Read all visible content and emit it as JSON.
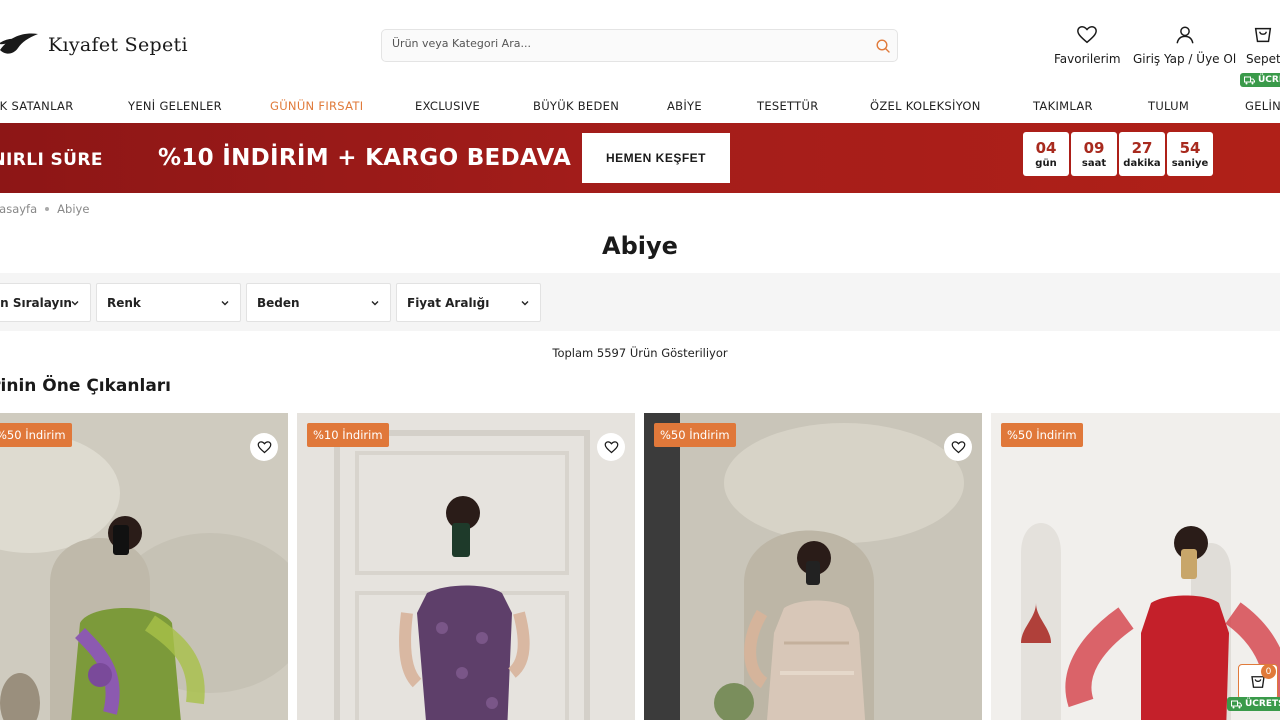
{
  "brand": {
    "name": "Kıyafet Sepeti"
  },
  "search": {
    "placeholder": "Ürün veya Kategori Ara..."
  },
  "header_actions": {
    "favorites": "Favorilerim",
    "login": "Giriş Yap / Üye Ol",
    "cart": "Sepet",
    "free_shipping": "ÜCRE"
  },
  "nav": [
    {
      "label": "ÇOK SATANLAR"
    },
    {
      "label": "YENİ GELENLER"
    },
    {
      "label": "GÜNÜN FIRSATI",
      "highlight": true
    },
    {
      "label": "EXCLUSIVE"
    },
    {
      "label": "BÜYÜK BEDEN"
    },
    {
      "label": "ABİYE"
    },
    {
      "label": "TESETTÜR"
    },
    {
      "label": "ÖZEL KOLEKSİYON"
    },
    {
      "label": "TAKIMLAR"
    },
    {
      "label": "TULUM"
    },
    {
      "label": "GELİNLİK"
    }
  ],
  "banner": {
    "left_text": "SINIRLI SÜRE",
    "main_text": "%10 İNDİRİM + KARGO BEDAVA",
    "cta": "HEMEN KEŞFET",
    "countdown": [
      {
        "value": "04",
        "unit": "gün"
      },
      {
        "value": "09",
        "unit": "saat"
      },
      {
        "value": "27",
        "unit": "dakika"
      },
      {
        "value": "54",
        "unit": "saniye"
      }
    ]
  },
  "breadcrumb": {
    "home": "Anasayfa",
    "current": "Abiye"
  },
  "page_title": "Abiye",
  "filters": {
    "sort": "Önerilen Sıralayın",
    "color": "Renk",
    "size": "Beden",
    "price": "Fiyat Aralığı"
  },
  "total_text": "Toplam 5597 Ürün Gösteriliyor",
  "section_title": "Kategorinin Öne Çıkanları",
  "products": [
    {
      "badge": "%50 İndirim",
      "dress_color": "#7c9a3a"
    },
    {
      "badge": "%10 İndirim",
      "dress_color": "#5e3f6a"
    },
    {
      "badge": "%50 İndirim",
      "dress_color": "#d8c7b8"
    },
    {
      "badge": "%50 İndirim",
      "dress_color": "#c4202a"
    }
  ],
  "mini_cart": {
    "count": "0",
    "free_shipping": "ÜCRETSİZ"
  },
  "colors": {
    "accent": "#e07a3a",
    "banner": "#a41d1a",
    "free_badge": "#3a9a4a"
  }
}
